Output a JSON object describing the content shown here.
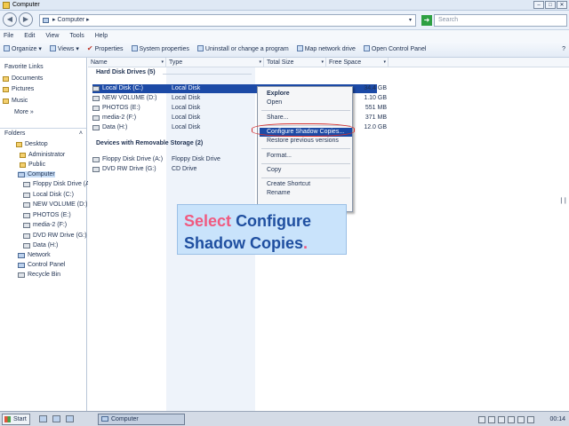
{
  "window": {
    "title": "Computer"
  },
  "address": {
    "path": "▸ Computer ▸",
    "search_placeholder": "Search"
  },
  "menu": [
    "File",
    "Edit",
    "View",
    "Tools",
    "Help"
  ],
  "toolbar": [
    "Organize ▾",
    "Views ▾",
    "Properties",
    "System properties",
    "Uninstall or change a program",
    "Map network drive",
    "Open Control Panel"
  ],
  "favorites": {
    "heading": "Favorite Links",
    "items": [
      "Documents",
      "Pictures",
      "Music",
      "More »"
    ]
  },
  "folders": {
    "heading": "Folders",
    "items": [
      "Desktop",
      "Administrator",
      "Public",
      "Computer",
      "Floppy Disk Drive (A:)",
      "Local Disk (C:)",
      "NEW VOLUME (D:)",
      "PHOTOS (E:)",
      "media-2 (F:)",
      "DVD RW Drive (G:)",
      "Data (H:)",
      "Network",
      "Control Panel",
      "Recycle Bin"
    ]
  },
  "columns": [
    "Name",
    "Type",
    "Total Size",
    "Free Space"
  ],
  "groups": {
    "hdd": "Hard Disk Drives (5)",
    "removable": "Devices with Removable Storage (2)"
  },
  "drives": [
    {
      "name": "Local Disk (C:)",
      "type": "Local Disk",
      "free": "34.4 GB"
    },
    {
      "name": "NEW VOLUME (D:)",
      "type": "Local Disk",
      "free": "1.10 GB"
    },
    {
      "name": "PHOTOS (E:)",
      "type": "Local Disk",
      "free": "551 MB"
    },
    {
      "name": "media-2 (F:)",
      "type": "Local Disk",
      "free": "371 MB"
    },
    {
      "name": "Data (H:)",
      "type": "Local Disk",
      "free": "12.0 GB"
    }
  ],
  "removable": [
    {
      "name": "Floppy Disk Drive (A:)",
      "type": "Floppy Disk Drive"
    },
    {
      "name": "DVD RW Drive (G:)",
      "type": "CD Drive"
    }
  ],
  "context_menu": {
    "explore": "Explore",
    "open": "Open",
    "share": "Share...",
    "configure": "Configure Shadow Copies...",
    "restore": "Restore previous versions",
    "format": "Format...",
    "copy": "Copy",
    "shortcut": "Create Shortcut",
    "rename": "Rename"
  },
  "callout": {
    "word1": "Select",
    "word2": "Configure",
    "line2": "Shadow Copies",
    "dot": "."
  },
  "taskbar": {
    "start": "Start",
    "task": "Computer",
    "clock": "00:14"
  },
  "colors": {
    "selection": "#1c4aa6",
    "callout_bg": "#c9e3fb",
    "callout_blue": "#1f4fa0",
    "callout_pink": "#f05a80",
    "highlight_ring": "#d43030"
  }
}
